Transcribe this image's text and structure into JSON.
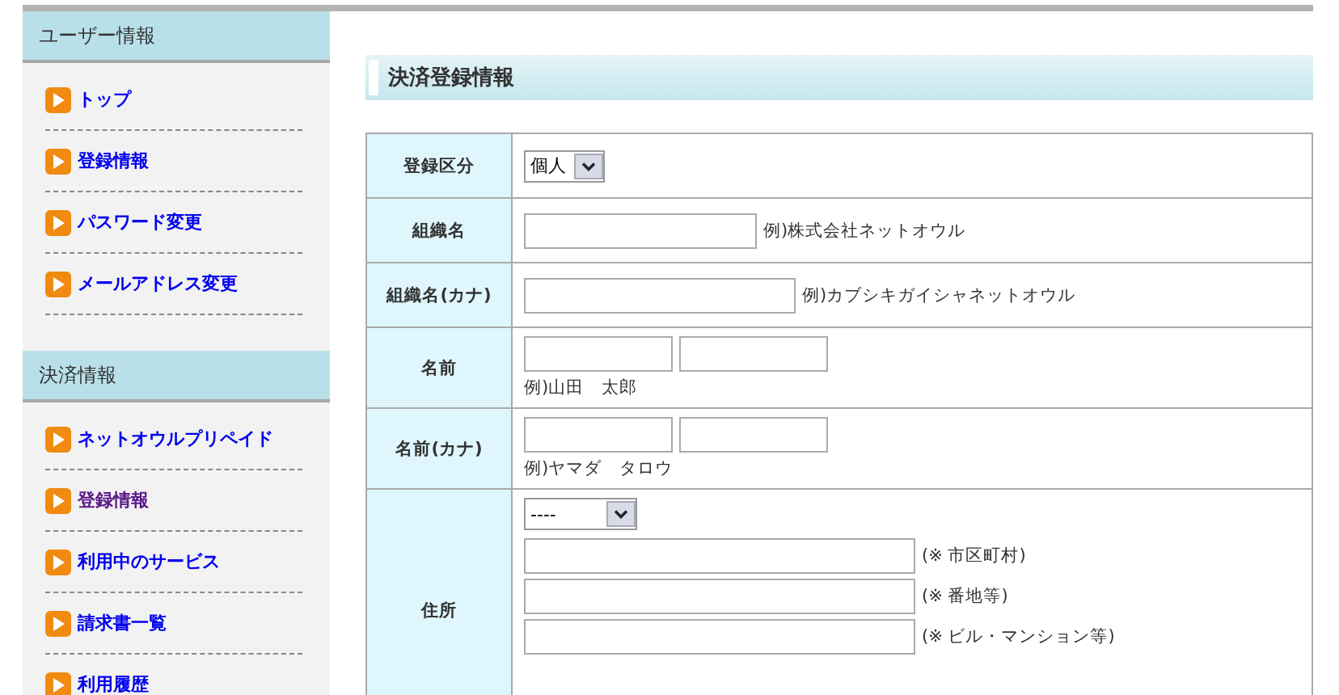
{
  "sidebar": [
    {
      "title": "ユーザー情報",
      "items": [
        {
          "label": "トップ",
          "visited": false
        },
        {
          "label": "登録情報",
          "visited": false
        },
        {
          "label": "パスワード変更",
          "visited": false
        },
        {
          "label": "メールアドレス変更",
          "visited": false
        }
      ]
    },
    {
      "title": "決済情報",
      "items": [
        {
          "label": "ネットオウルプリペイド",
          "visited": false
        },
        {
          "label": "登録情報",
          "visited": true
        },
        {
          "label": "利用中のサービス",
          "visited": false
        },
        {
          "label": "請求書一覧",
          "visited": false
        },
        {
          "label": "利用履歴",
          "visited": false
        }
      ]
    }
  ],
  "heading": "決済登録情報",
  "form": [
    {
      "kind": "select",
      "label": "登録区分",
      "value": "個人"
    },
    {
      "kind": "text",
      "label": "組織名",
      "example": "例)株式会社ネットオウル",
      "wide": false
    },
    {
      "kind": "text",
      "label": "組織名(カナ)",
      "example": "例)カブシキガイシャネットオウル",
      "wide": true
    },
    {
      "kind": "name",
      "label": "名前",
      "example": "例)山田　太郎"
    },
    {
      "kind": "name",
      "label": "名前(カナ)",
      "example": "例)ヤマダ　タロウ"
    },
    {
      "kind": "address",
      "label": "住所",
      "value": "----",
      "notes": [
        "(※ 市区町村)",
        "(※ 番地等)",
        "(※ ビル・マンション等)"
      ]
    }
  ]
}
